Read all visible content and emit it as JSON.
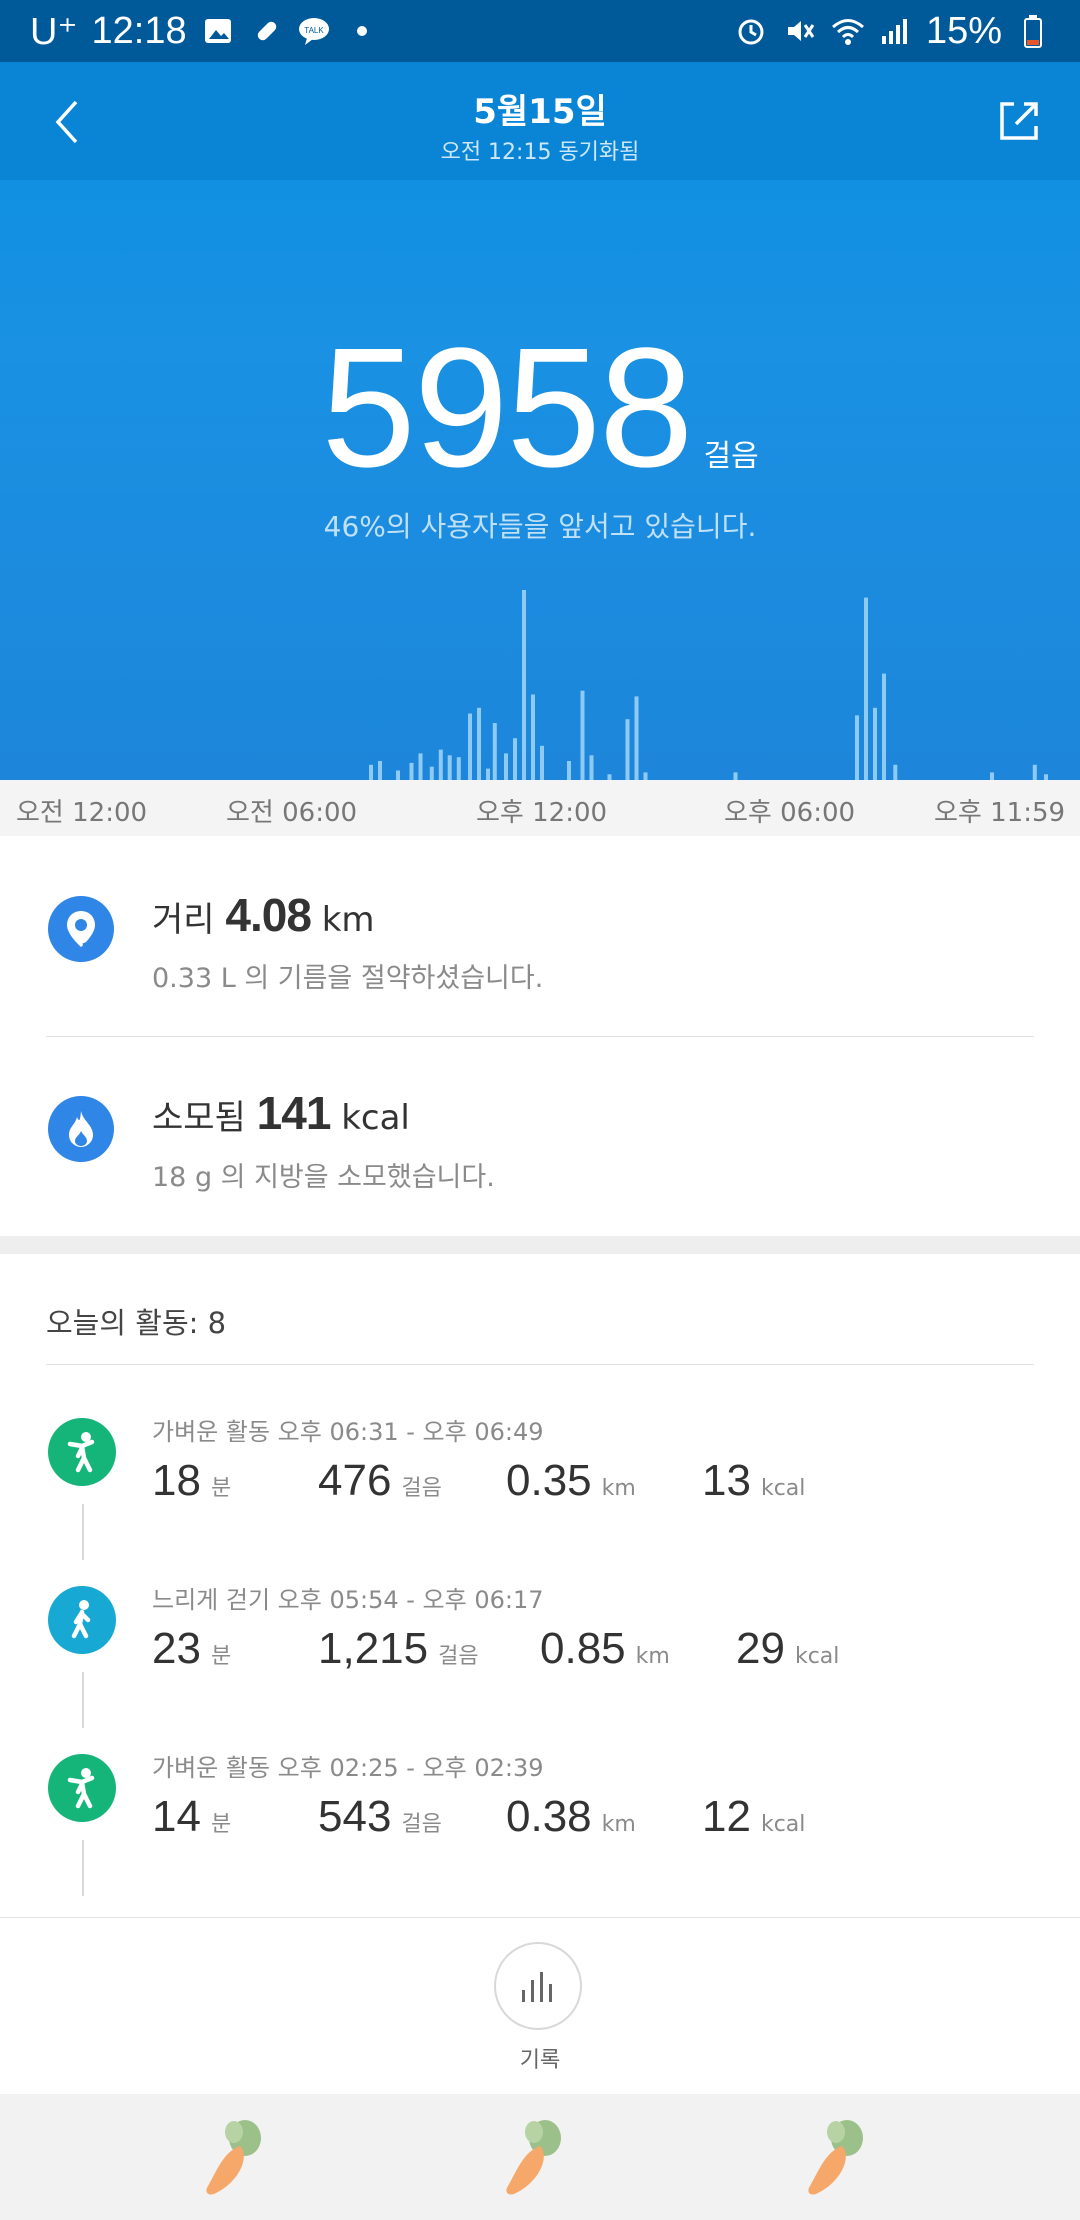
{
  "status_bar": {
    "carrier": "U⁺",
    "time": "12:18",
    "battery": "15%"
  },
  "header": {
    "title": "5월15일",
    "subtitle": "오전 12:15 동기화됨"
  },
  "summary": {
    "steps": "5958",
    "steps_unit": "걸음",
    "rank_text": "46%의 사용자들을 앞서고 있습니다."
  },
  "chart_data": {
    "type": "bar",
    "x_labels": [
      "오전 12:00",
      "오전 06:00",
      "오후 12:00",
      "오후 06:00",
      "오후 11:59"
    ],
    "bars_by_hour_fraction": [
      [
        8.2,
        0.08
      ],
      [
        8.4,
        0.1
      ],
      [
        8.8,
        0.05
      ],
      [
        9.1,
        0.09
      ],
      [
        9.3,
        0.14
      ],
      [
        9.55,
        0.07
      ],
      [
        9.75,
        0.16
      ],
      [
        9.95,
        0.13
      ],
      [
        10.15,
        0.12
      ],
      [
        10.4,
        0.35
      ],
      [
        10.6,
        0.38
      ],
      [
        10.8,
        0.06
      ],
      [
        10.95,
        0.3
      ],
      [
        11.2,
        0.14
      ],
      [
        11.4,
        0.22
      ],
      [
        11.6,
        1.0
      ],
      [
        11.8,
        0.45
      ],
      [
        12.0,
        0.18
      ],
      [
        12.6,
        0.1
      ],
      [
        12.9,
        0.47
      ],
      [
        13.1,
        0.13
      ],
      [
        13.5,
        0.03
      ],
      [
        13.9,
        0.32
      ],
      [
        14.1,
        0.44
      ],
      [
        14.3,
        0.04
      ],
      [
        16.3,
        0.04
      ],
      [
        19.0,
        0.34
      ],
      [
        19.2,
        0.96
      ],
      [
        19.4,
        0.38
      ],
      [
        19.6,
        0.56
      ],
      [
        19.85,
        0.08
      ],
      [
        22.0,
        0.04
      ],
      [
        22.95,
        0.08
      ],
      [
        23.2,
        0.03
      ]
    ],
    "bar_color": "#8fcaf3"
  },
  "metrics": {
    "distance": {
      "label": "거리",
      "value": "4.08",
      "unit": "km",
      "sub": "0.33 L 의 기름을 절약하셨습니다."
    },
    "calories": {
      "label": "소모됨",
      "value": "141",
      "unit": "kcal",
      "sub": "18 g 의 지방을 소모했습니다."
    }
  },
  "activities_header": "오늘의 활동:  8",
  "activities": [
    {
      "time": "가벼운 활동 오후 06:31 - 오후 06:49",
      "minutes": "18",
      "min_unit": "분",
      "steps": "476",
      "steps_unit": "걸음",
      "distance": "0.35",
      "dist_unit": "km",
      "kcal": "13",
      "kcal_unit": "kcal",
      "icon": "light-activity-icon",
      "color": "#15b57a"
    },
    {
      "time": "느리게 걷기 오후 05:54 - 오후 06:17",
      "minutes": "23",
      "min_unit": "분",
      "steps": "1,215",
      "steps_unit": "걸음",
      "distance": "0.85",
      "dist_unit": "km",
      "kcal": "29",
      "kcal_unit": "kcal",
      "icon": "slow-walk-icon",
      "color": "#17a9d4"
    },
    {
      "time": "가벼운 활동 오후 02:25 - 오후 02:39",
      "minutes": "14",
      "min_unit": "분",
      "steps": "543",
      "steps_unit": "걸음",
      "distance": "0.38",
      "dist_unit": "km",
      "kcal": "12",
      "kcal_unit": "kcal",
      "icon": "light-activity-icon",
      "color": "#15b57a"
    }
  ],
  "record": {
    "label": "기록"
  },
  "colors": {
    "brand_blue": "#0a85d6",
    "accent_blue": "#2f86e6",
    "green": "#15b57a",
    "teal": "#17a9d4"
  }
}
